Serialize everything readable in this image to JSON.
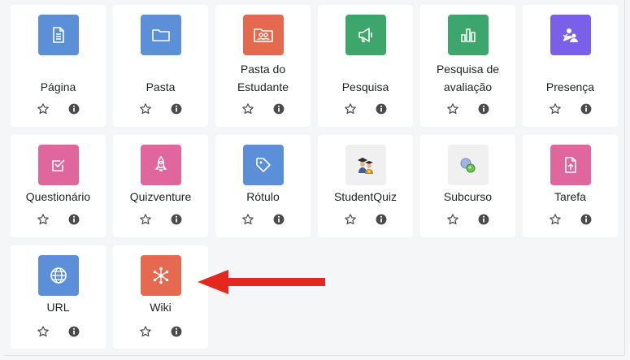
{
  "modules": [
    {
      "label_lines": [
        "Página"
      ],
      "color": "#5b8fd8",
      "icon": "page-icon"
    },
    {
      "label_lines": [
        "Pasta"
      ],
      "color": "#5b8fd8",
      "icon": "folder-icon"
    },
    {
      "label_lines": [
        "Pasta do",
        "Estudante"
      ],
      "color": "#e5694f",
      "icon": "student-folder-icon"
    },
    {
      "label_lines": [
        "Pesquisa"
      ],
      "color": "#3da66c",
      "icon": "megaphone-icon"
    },
    {
      "label_lines": [
        "Pesquisa de",
        "avaliação"
      ],
      "color": "#3da66c",
      "icon": "bar-chart-icon"
    },
    {
      "label_lines": [
        "Presença"
      ],
      "color": "#7a5fe8",
      "icon": "attendance-icon"
    },
    {
      "label_lines": [
        "Questionário"
      ],
      "color": "#e0679e",
      "icon": "checkbox-icon"
    },
    {
      "label_lines": [
        "Quizventure"
      ],
      "color": "#e0679e",
      "icon": "rocket-icon"
    },
    {
      "label_lines": [
        "Rótulo"
      ],
      "color": "#5b8fd8",
      "icon": "tag-icon"
    },
    {
      "label_lines": [
        "StudentQuiz"
      ],
      "color": "#f0f0f0",
      "icon": "graduates-icon"
    },
    {
      "label_lines": [
        "Subcurso"
      ],
      "color": "#f0f0f0",
      "icon": "subcourse-icon"
    },
    {
      "label_lines": [
        "Tarefa"
      ],
      "color": "#e0679e",
      "icon": "assignment-icon"
    },
    {
      "label_lines": [
        "URL"
      ],
      "color": "#5b8fd8",
      "icon": "globe-icon"
    },
    {
      "label_lines": [
        "Wiki"
      ],
      "color": "#e5694f",
      "icon": "wiki-icon"
    }
  ],
  "annotation": {
    "arrow_color": "#e5281e"
  }
}
